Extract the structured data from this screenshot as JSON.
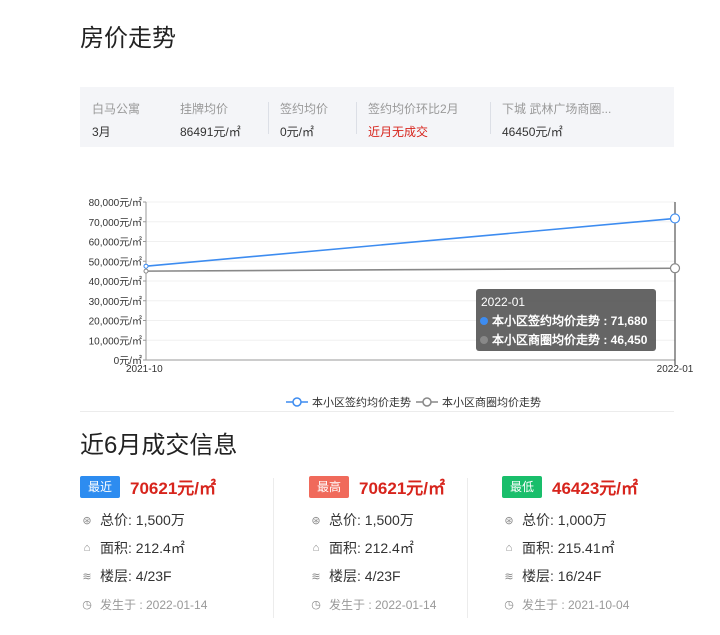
{
  "page": {
    "title": "房价走势"
  },
  "summary": {
    "community": {
      "name": "白马公寓",
      "month": "3月"
    },
    "listing": {
      "label": "挂牌均价",
      "value": "86491元/㎡"
    },
    "signed": {
      "label": "签约均价",
      "value": "0元/㎡"
    },
    "mom": {
      "label": "签约均价环比2月",
      "value": "近月无成交"
    },
    "area": {
      "label": "下城 武林广场商圈...",
      "value": "46450元/㎡"
    }
  },
  "colors": {
    "blue": "#3d8cf0",
    "gray": "#888888",
    "red": "#d7241c",
    "badge_recent": "#2d8cf0",
    "badge_high": "#f06a5b",
    "badge_low": "#19be6b"
  },
  "chart_data": {
    "type": "line",
    "x": [
      "2021-10",
      "2022-01"
    ],
    "ylim": [
      0,
      80000
    ],
    "yticks": [
      "0元/㎡",
      "10,000元/㎡",
      "20,000元/㎡",
      "30,000元/㎡",
      "40,000元/㎡",
      "50,000元/㎡",
      "60,000元/㎡",
      "70,000元/㎡",
      "80,000元/㎡"
    ],
    "series": [
      {
        "name": "本小区签约均价走势",
        "values": [
          47500,
          71680
        ]
      },
      {
        "name": "本小区商圈均价走势",
        "values": [
          45000,
          46450
        ]
      }
    ],
    "legend": "bottom",
    "tooltip": {
      "title": "2022-01",
      "rows": [
        "本小区签约均价走势 : 71,680",
        "本小区商圈均价走势 : 46,450"
      ]
    }
  },
  "deals": {
    "title": "近6月成交信息",
    "items": [
      {
        "badge": "最近",
        "price": "70621元/㎡",
        "total": "总价: 1,500万",
        "area": "面积: 212.4㎡",
        "floor": "楼层: 4/23F",
        "date": "发生于 : 2022-01-14"
      },
      {
        "badge": "最高",
        "price": "70621元/㎡",
        "total": "总价: 1,500万",
        "area": "面积: 212.4㎡",
        "floor": "楼层: 4/23F",
        "date": "发生于 : 2022-01-14"
      },
      {
        "badge": "最低",
        "price": "46423元/㎡",
        "total": "总价: 1,000万",
        "area": "面积: 215.41㎡",
        "floor": "楼层: 16/24F",
        "date": "发生于 : 2021-10-04"
      }
    ]
  }
}
